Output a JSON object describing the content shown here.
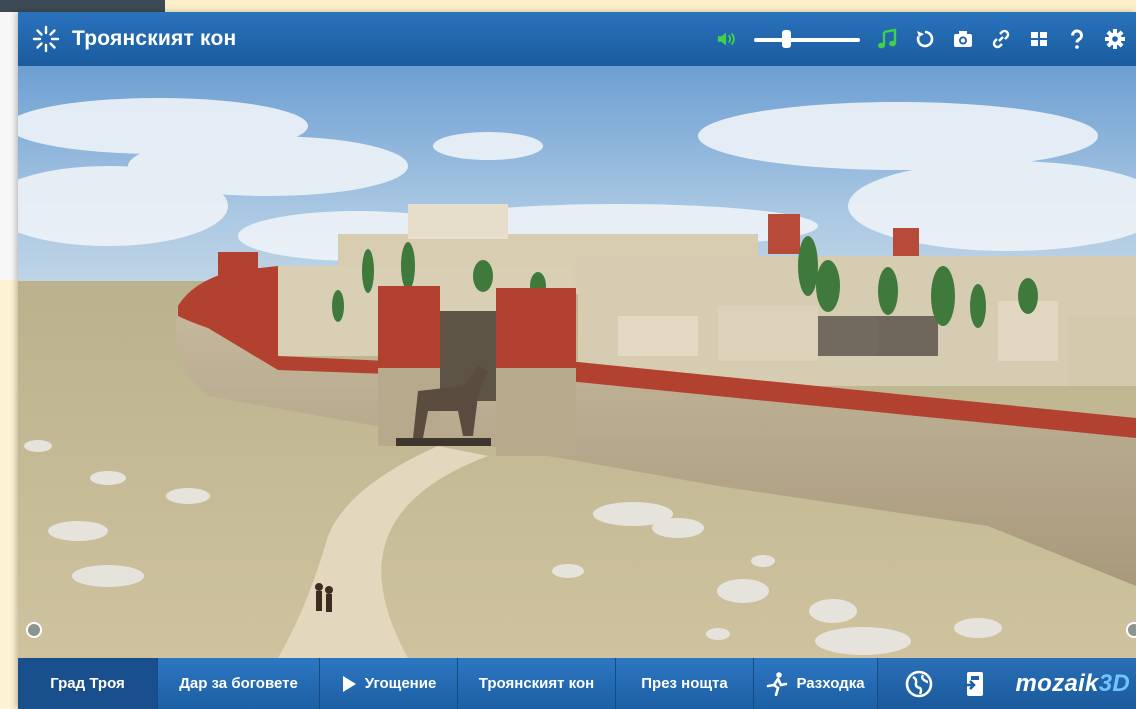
{
  "window": {
    "title": "Троянският кон",
    "title_icon": "loading-sparkle-icon"
  },
  "toolbar": {
    "volume_icon": "speaker-icon",
    "volume_level": 0.3,
    "music_icon": "music-note-icon",
    "reset_icon": "rotate-icon",
    "screenshot_icon": "camera-icon",
    "link_icon": "link-icon",
    "grid_icon": "grid-icon",
    "help_icon": "help-icon",
    "settings_icon": "gear-icon",
    "accent_color": "#3fd24a"
  },
  "scenes": [
    {
      "label": "Град Троя",
      "active": true,
      "icon": null
    },
    {
      "label": "Дар за боговете",
      "active": false,
      "icon": null
    },
    {
      "label": "Угощение",
      "active": false,
      "icon": "play-icon"
    },
    {
      "label": "Троянският кон",
      "active": false,
      "icon": null
    },
    {
      "label": "През нощта",
      "active": false,
      "icon": null
    },
    {
      "label": "Разходка",
      "active": false,
      "icon": "walking-person-icon"
    }
  ],
  "bottom": {
    "globe_icon": "globe-icon",
    "exit_icon": "exit-icon",
    "brand_main": "mozaik",
    "brand_accent": "3D"
  },
  "colors": {
    "bar": "#1d5fa3",
    "active_tab": "#184f8c",
    "brand_accent": "#6fc3ff"
  }
}
